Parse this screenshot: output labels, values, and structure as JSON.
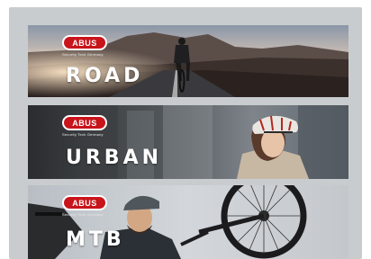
{
  "brand": {
    "logo_text": "ABUS",
    "tagline": "Security Tech Germany",
    "accent_color": "#c8141b"
  },
  "panels": [
    {
      "title": "ROAD"
    },
    {
      "title": "URBAN"
    },
    {
      "title": "MTB"
    }
  ]
}
